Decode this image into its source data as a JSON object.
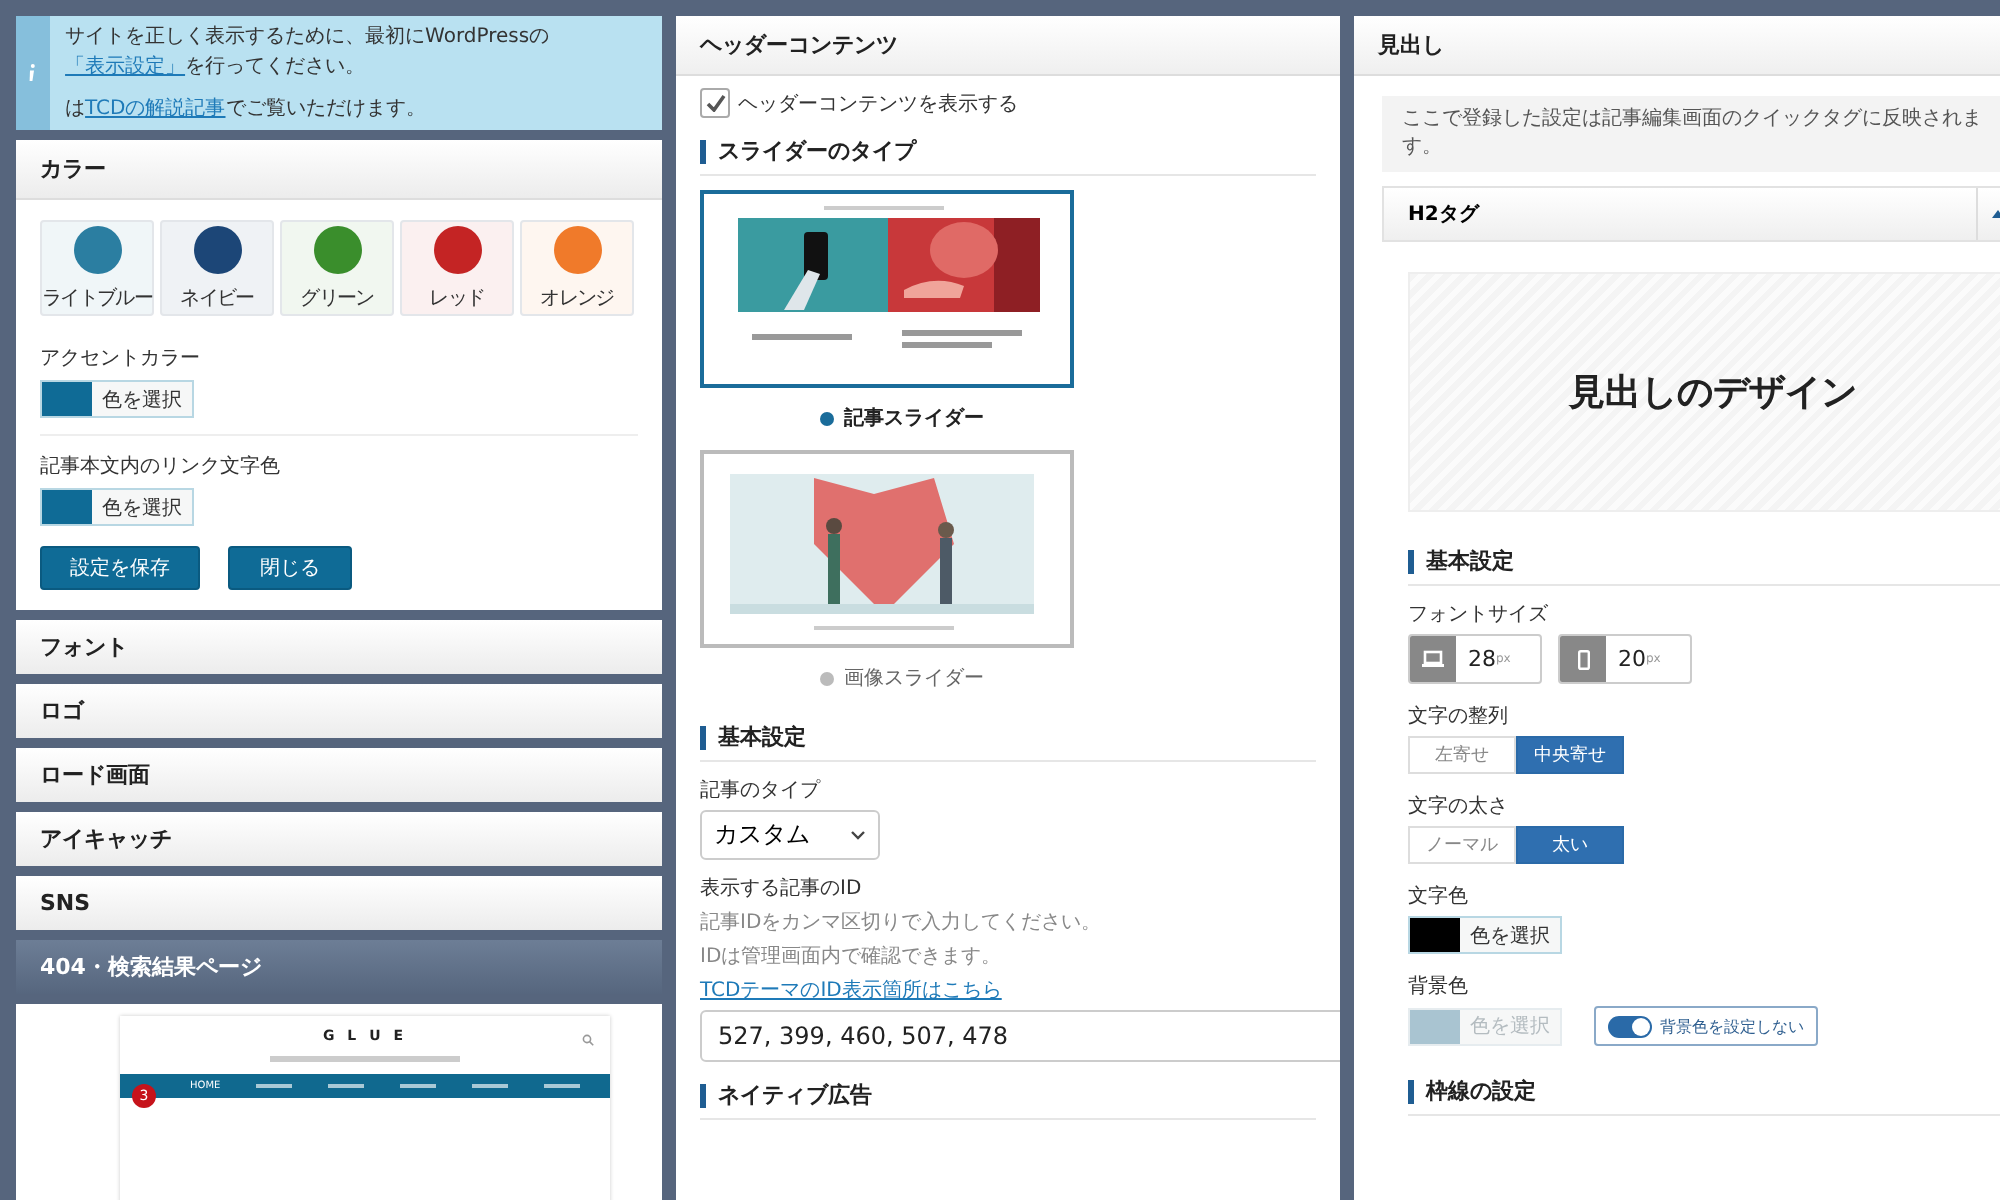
{
  "notice": {
    "lines": [
      [
        {
          "kind": "text",
          "text": "サイトを正しく表示するために、最初にWordPressの"
        },
        {
          "kind": "link",
          "text": "「表示設定」"
        },
        {
          "kind": "text",
          "text": "を行ってください。"
        }
      ],
      [
        {
          "kind": "text",
          "text": "は"
        },
        {
          "kind": "link",
          "text": "TCDの解説記事"
        },
        {
          "kind": "text",
          "text": "でご覧いただけます。"
        }
      ]
    ]
  },
  "left_panel": {
    "color_section": {
      "title": "カラー",
      "presets": [
        {
          "label": "ライトブルー",
          "color": "#2b7ea1"
        },
        {
          "label": "ネイビー",
          "color": "#1c4677"
        },
        {
          "label": "グリーン",
          "color": "#3a8e2c"
        },
        {
          "label": "レッド",
          "color": "#c42424"
        },
        {
          "label": "オレンジ",
          "color": "#f07a2a"
        }
      ],
      "fields": [
        {
          "label": "アクセントカラー",
          "button": "色を選択",
          "color": "#0f6b96"
        },
        {
          "label": "記事本文内のリンク文字色",
          "button": "色を選択",
          "color": "#0f6b96"
        }
      ],
      "buttons": [
        "設定を保存",
        "閉じる"
      ]
    },
    "sections": [
      {
        "title": "フォント",
        "selected": false
      },
      {
        "title": "ロゴ",
        "selected": false
      },
      {
        "title": "ロード画面",
        "selected": false
      },
      {
        "title": "アイキャッチ",
        "selected": false
      },
      {
        "title": "SNS",
        "selected": false
      },
      {
        "title": "404・検索結果ページ",
        "selected": true
      }
    ],
    "preview": {
      "logo": "G L U E",
      "nav": [
        "HOME"
      ],
      "badge": "3"
    }
  },
  "middle_panel": {
    "title": "ヘッダーコンテンツ",
    "checkbox": {
      "label": "ヘッダーコンテンツを表示する",
      "checked": true
    },
    "slider_heading": "スライダーのタイプ",
    "slider_types": [
      {
        "label": "記事スライダー",
        "kind": "posts",
        "selected": true
      },
      {
        "label": "画像スライダー",
        "selected": false
      }
    ],
    "basic_heading": "基本設定",
    "post_type": {
      "label": "記事のタイプ",
      "value": "カスタム"
    },
    "post_ids": {
      "label": "表示する記事のID",
      "help": [
        "記事IDをカンマ区切りで入力してください。",
        "IDは管理画面内で確認できます。"
      ],
      "link": "TCDテーマのID表示箇所はこちら",
      "value": "527, 399, 460, 507, 478"
    },
    "next_heading": "ネイティブ広告"
  },
  "right_panel": {
    "title": "見出し",
    "notice": "ここで登録した設定は記事編集画面のクイックタグに反映されます。",
    "tag": {
      "title": "H2タグ",
      "expanded": true
    },
    "preview_text": "見出しのデザイン",
    "basic_heading": "基本設定",
    "font_size": {
      "label": "フォントサイズ",
      "fields": [
        {
          "kind": "desktop",
          "value": "28",
          "unit": "px"
        },
        {
          "kind": "mobile",
          "value": "20",
          "unit": "px"
        }
      ]
    },
    "align": {
      "label": "文字の整列",
      "options": [
        {
          "label": "左寄せ",
          "selected": false
        },
        {
          "label": "中央寄せ",
          "selected": true
        }
      ]
    },
    "weight": {
      "label": "文字の太さ",
      "options": [
        {
          "label": "ノーマル",
          "selected": false
        },
        {
          "label": "太い",
          "selected": true
        }
      ]
    },
    "text_color": {
      "label": "文字色",
      "button": "色を選択",
      "color": "#000000",
      "disabled": false
    },
    "bg_color": {
      "label": "背景色",
      "button": "色を選択",
      "color": "#a9c4d1",
      "disabled": true,
      "toggle": {
        "label": "背景色を設定しない",
        "on": true
      }
    },
    "next_heading": "枠線の設定"
  }
}
